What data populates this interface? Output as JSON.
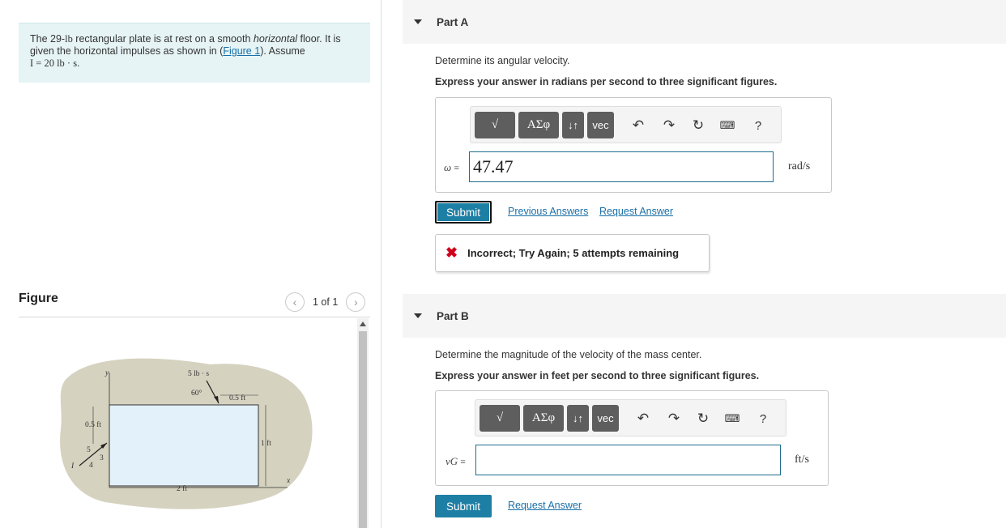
{
  "problem": {
    "line1_a": "The 29-",
    "line1_unit": "lb",
    "line1_b": " rectangular plate is at rest on a smooth ",
    "line1_em": "horizontal",
    "line1_c": " floor. It is",
    "line2": "given the horizontal impulses as shown in (",
    "figure_link": "Figure 1",
    "line2_end": "). Assume",
    "line3": "I = 20 lb · s."
  },
  "figure": {
    "title": "Figure",
    "counter": "1 of 1",
    "labels": {
      "y": "y",
      "x": "x",
      "impulse_top": "5 lb · s",
      "angle": "60°",
      "offset_top": "0.5 ft",
      "left_dim": "0.5 ft",
      "height": "1 ft",
      "width": "2 ft",
      "I": "I",
      "tri_5": "5",
      "tri_3": "3",
      "tri_4": "4"
    }
  },
  "partA": {
    "label": "Part A",
    "instruction": "Determine its angular velocity.",
    "express": "Express your answer in radians per second to three significant figures.",
    "var_symbol": "ω",
    "eq": "=",
    "value": "47.47",
    "unit": "rad/s",
    "submit": "Submit",
    "prev_answers": "Previous Answers",
    "request_answer": "Request Answer",
    "feedback_icon": "✖",
    "feedback": "Incorrect; Try Again; 5 attempts remaining"
  },
  "partB": {
    "label": "Part B",
    "instruction": "Determine the magnitude of the velocity of the mass center.",
    "express": "Express your answer in feet per second to three significant figures.",
    "var_symbol": "vG",
    "eq": "=",
    "value": "",
    "unit": "ft/s",
    "submit": "Submit",
    "request_answer": "Request Answer"
  },
  "toolbar": {
    "templates": "√",
    "greek": "ΑΣφ",
    "arrows": "↓↑",
    "vec": "vec",
    "help": "?"
  },
  "colors": {
    "accent": "#1e7fa5",
    "problem_bg": "#e6f4f5",
    "error": "#d0021b"
  }
}
